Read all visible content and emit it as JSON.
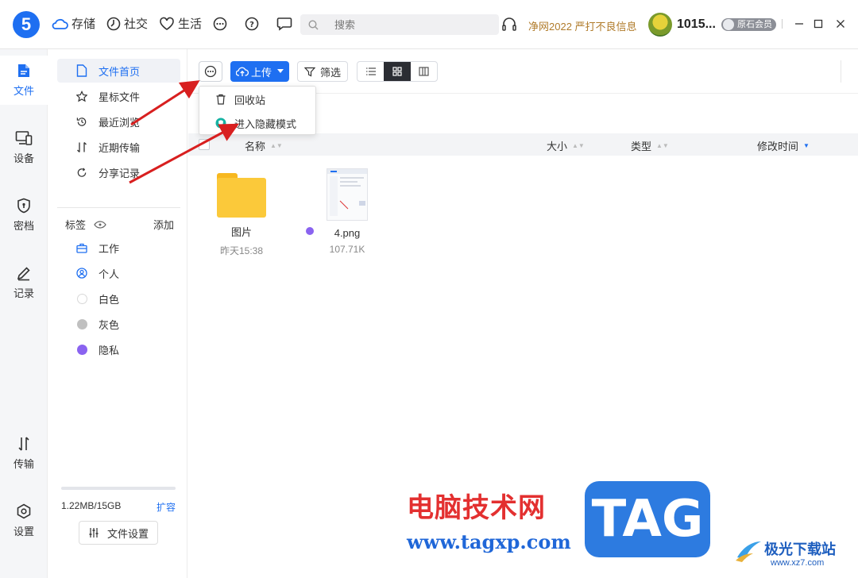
{
  "app": {
    "logo_text": "5",
    "nav": [
      {
        "label": "存储",
        "icon": "cloud-icon"
      },
      {
        "label": "社交",
        "icon": "clock-icon"
      },
      {
        "label": "生活",
        "icon": "heart-icon"
      }
    ],
    "search_placeholder": "搜索",
    "promo": "净网2022 严打不良信息",
    "user_id": "1015...",
    "vip_label": "原石会员"
  },
  "rail": [
    {
      "label": "文件",
      "icon": "files-icon",
      "active": true
    },
    {
      "label": "设备",
      "icon": "devices-icon"
    },
    {
      "label": "密档",
      "icon": "shield-icon"
    },
    {
      "label": "记录",
      "icon": "pencil-icon"
    },
    {
      "label": "传输",
      "icon": "transfer-icon"
    },
    {
      "label": "设置",
      "icon": "settings-icon"
    }
  ],
  "sidebar": {
    "items": [
      {
        "label": "文件首页",
        "icon": "file-icon",
        "active": true
      },
      {
        "label": "星标文件",
        "icon": "star-icon"
      },
      {
        "label": "最近浏览",
        "icon": "history-icon"
      },
      {
        "label": "近期传输",
        "icon": "transfer-icon"
      },
      {
        "label": "分享记录",
        "icon": "share-icon"
      }
    ],
    "tags_title": "标签",
    "tags_add": "添加",
    "tags": [
      {
        "label": "工作",
        "icon": "briefcase-icon"
      },
      {
        "label": "个人",
        "icon": "person-icon"
      },
      {
        "label": "白色",
        "color": "#ffffff"
      },
      {
        "label": "灰色",
        "color": "#c0c0c0"
      },
      {
        "label": "隐私",
        "color": "#8a63f0"
      }
    ],
    "storage": "1.22MB/15GB",
    "storage_used_fraction": 0.0001,
    "expand": "扩容",
    "file_settings": "文件设置"
  },
  "toolbar": {
    "upload": "上传",
    "filter": "筛选"
  },
  "dropdown": {
    "items": [
      {
        "label": "回收站",
        "icon": "trash-icon"
      },
      {
        "label": "进入隐藏模式",
        "icon": "hidden-mode-icon"
      }
    ]
  },
  "columns": {
    "name": "名称",
    "size": "大小",
    "type": "类型",
    "modified": "修改时间"
  },
  "files": [
    {
      "name": "图片",
      "meta": "昨天15:38",
      "kind": "folder"
    },
    {
      "name": "4.png",
      "meta": "107.71K",
      "kind": "image",
      "tag_color": "#8a63f0"
    }
  ],
  "watermark": {
    "cn": "电脑技术网",
    "url": "www.tagxp.com",
    "tag": "TAG",
    "site": "极光下载站",
    "site_url": "www.xz7.com"
  }
}
